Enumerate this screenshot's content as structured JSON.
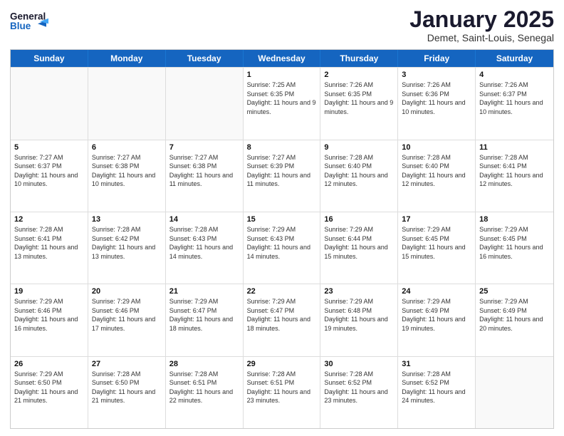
{
  "header": {
    "logo_general": "General",
    "logo_blue": "Blue",
    "title": "January 2025",
    "subtitle": "Demet, Saint-Louis, Senegal"
  },
  "days_of_week": [
    "Sunday",
    "Monday",
    "Tuesday",
    "Wednesday",
    "Thursday",
    "Friday",
    "Saturday"
  ],
  "weeks": [
    [
      {
        "day": "",
        "info": ""
      },
      {
        "day": "",
        "info": ""
      },
      {
        "day": "",
        "info": ""
      },
      {
        "day": "1",
        "info": "Sunrise: 7:25 AM\nSunset: 6:35 PM\nDaylight: 11 hours and 9 minutes."
      },
      {
        "day": "2",
        "info": "Sunrise: 7:26 AM\nSunset: 6:35 PM\nDaylight: 11 hours and 9 minutes."
      },
      {
        "day": "3",
        "info": "Sunrise: 7:26 AM\nSunset: 6:36 PM\nDaylight: 11 hours and 10 minutes."
      },
      {
        "day": "4",
        "info": "Sunrise: 7:26 AM\nSunset: 6:37 PM\nDaylight: 11 hours and 10 minutes."
      }
    ],
    [
      {
        "day": "5",
        "info": "Sunrise: 7:27 AM\nSunset: 6:37 PM\nDaylight: 11 hours and 10 minutes."
      },
      {
        "day": "6",
        "info": "Sunrise: 7:27 AM\nSunset: 6:38 PM\nDaylight: 11 hours and 10 minutes."
      },
      {
        "day": "7",
        "info": "Sunrise: 7:27 AM\nSunset: 6:38 PM\nDaylight: 11 hours and 11 minutes."
      },
      {
        "day": "8",
        "info": "Sunrise: 7:27 AM\nSunset: 6:39 PM\nDaylight: 11 hours and 11 minutes."
      },
      {
        "day": "9",
        "info": "Sunrise: 7:28 AM\nSunset: 6:40 PM\nDaylight: 11 hours and 12 minutes."
      },
      {
        "day": "10",
        "info": "Sunrise: 7:28 AM\nSunset: 6:40 PM\nDaylight: 11 hours and 12 minutes."
      },
      {
        "day": "11",
        "info": "Sunrise: 7:28 AM\nSunset: 6:41 PM\nDaylight: 11 hours and 12 minutes."
      }
    ],
    [
      {
        "day": "12",
        "info": "Sunrise: 7:28 AM\nSunset: 6:41 PM\nDaylight: 11 hours and 13 minutes."
      },
      {
        "day": "13",
        "info": "Sunrise: 7:28 AM\nSunset: 6:42 PM\nDaylight: 11 hours and 13 minutes."
      },
      {
        "day": "14",
        "info": "Sunrise: 7:28 AM\nSunset: 6:43 PM\nDaylight: 11 hours and 14 minutes."
      },
      {
        "day": "15",
        "info": "Sunrise: 7:29 AM\nSunset: 6:43 PM\nDaylight: 11 hours and 14 minutes."
      },
      {
        "day": "16",
        "info": "Sunrise: 7:29 AM\nSunset: 6:44 PM\nDaylight: 11 hours and 15 minutes."
      },
      {
        "day": "17",
        "info": "Sunrise: 7:29 AM\nSunset: 6:45 PM\nDaylight: 11 hours and 15 minutes."
      },
      {
        "day": "18",
        "info": "Sunrise: 7:29 AM\nSunset: 6:45 PM\nDaylight: 11 hours and 16 minutes."
      }
    ],
    [
      {
        "day": "19",
        "info": "Sunrise: 7:29 AM\nSunset: 6:46 PM\nDaylight: 11 hours and 16 minutes."
      },
      {
        "day": "20",
        "info": "Sunrise: 7:29 AM\nSunset: 6:46 PM\nDaylight: 11 hours and 17 minutes."
      },
      {
        "day": "21",
        "info": "Sunrise: 7:29 AM\nSunset: 6:47 PM\nDaylight: 11 hours and 18 minutes."
      },
      {
        "day": "22",
        "info": "Sunrise: 7:29 AM\nSunset: 6:47 PM\nDaylight: 11 hours and 18 minutes."
      },
      {
        "day": "23",
        "info": "Sunrise: 7:29 AM\nSunset: 6:48 PM\nDaylight: 11 hours and 19 minutes."
      },
      {
        "day": "24",
        "info": "Sunrise: 7:29 AM\nSunset: 6:49 PM\nDaylight: 11 hours and 19 minutes."
      },
      {
        "day": "25",
        "info": "Sunrise: 7:29 AM\nSunset: 6:49 PM\nDaylight: 11 hours and 20 minutes."
      }
    ],
    [
      {
        "day": "26",
        "info": "Sunrise: 7:29 AM\nSunset: 6:50 PM\nDaylight: 11 hours and 21 minutes."
      },
      {
        "day": "27",
        "info": "Sunrise: 7:28 AM\nSunset: 6:50 PM\nDaylight: 11 hours and 21 minutes."
      },
      {
        "day": "28",
        "info": "Sunrise: 7:28 AM\nSunset: 6:51 PM\nDaylight: 11 hours and 22 minutes."
      },
      {
        "day": "29",
        "info": "Sunrise: 7:28 AM\nSunset: 6:51 PM\nDaylight: 11 hours and 23 minutes."
      },
      {
        "day": "30",
        "info": "Sunrise: 7:28 AM\nSunset: 6:52 PM\nDaylight: 11 hours and 23 minutes."
      },
      {
        "day": "31",
        "info": "Sunrise: 7:28 AM\nSunset: 6:52 PM\nDaylight: 11 hours and 24 minutes."
      },
      {
        "day": "",
        "info": ""
      }
    ]
  ]
}
